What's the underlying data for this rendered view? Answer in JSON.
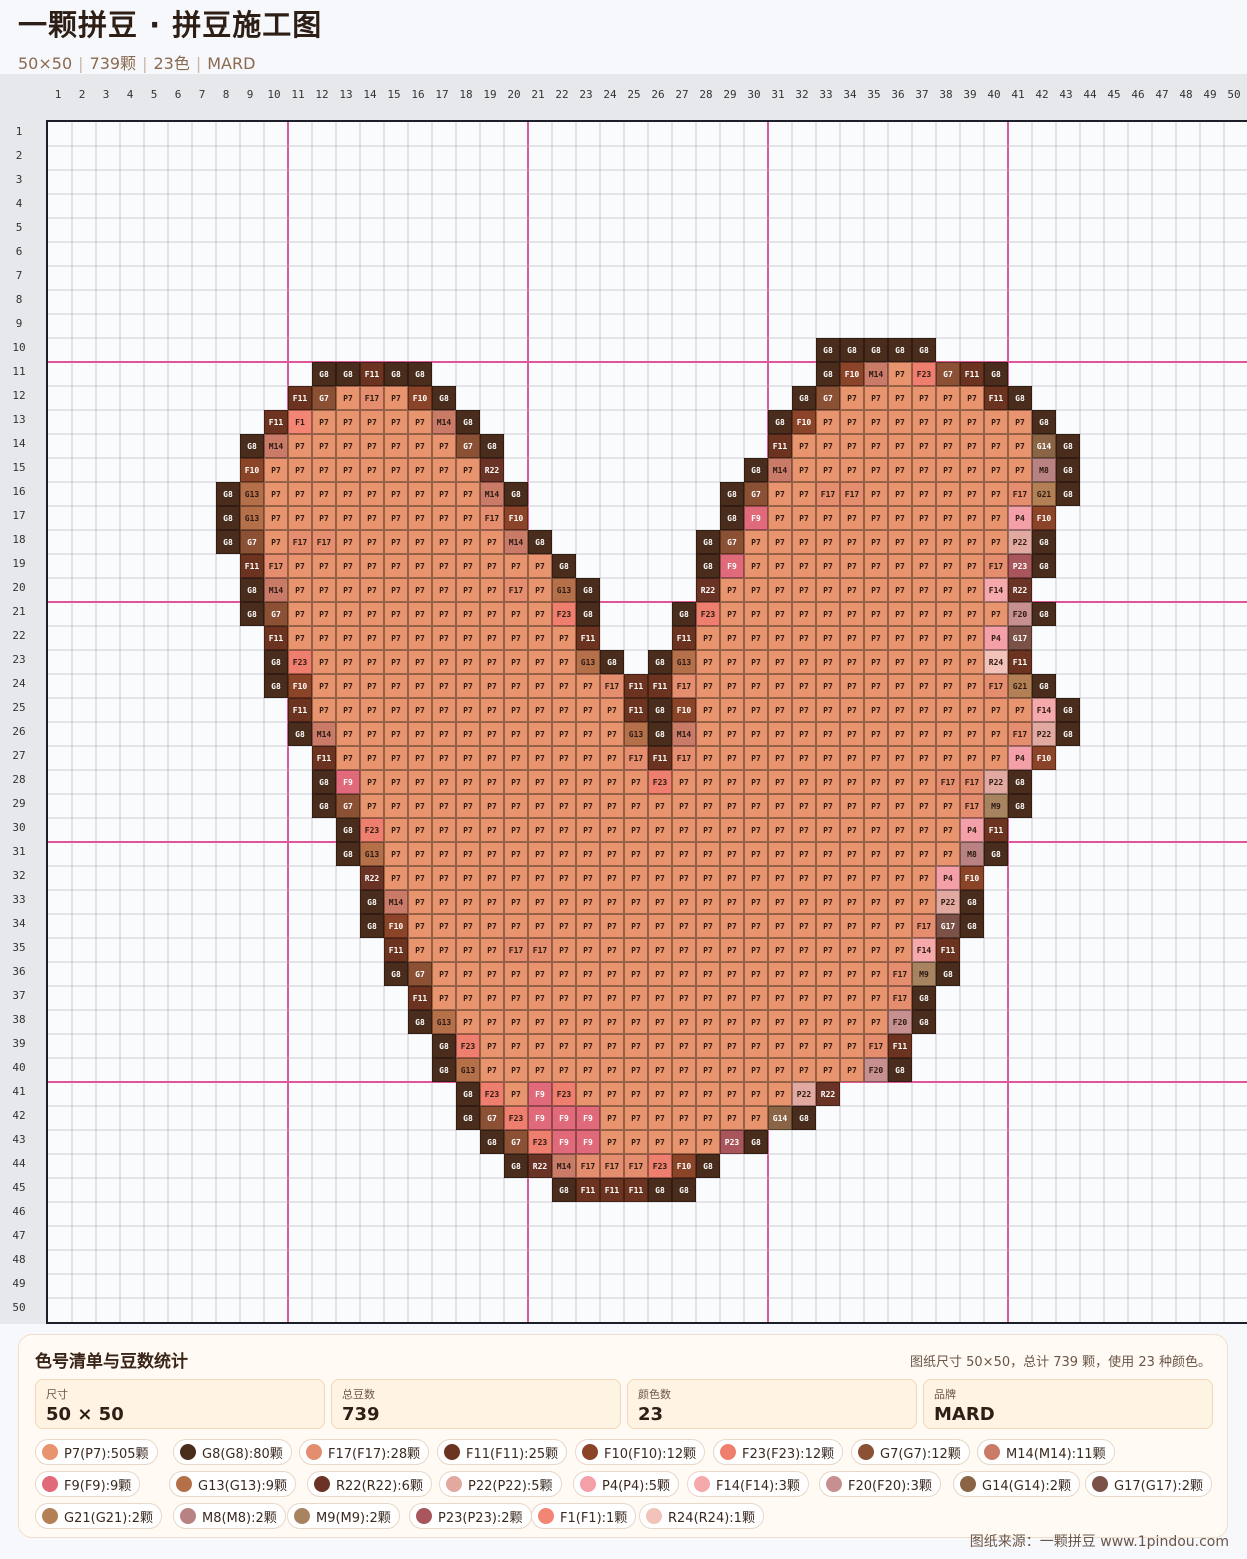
{
  "header": {
    "title": "一颗拼豆 · 拼豆施工图",
    "size": "50×50",
    "beads": "739颗",
    "colors": "23色",
    "brand": "MARD"
  },
  "grid": {
    "cols": 50,
    "rows": 50
  },
  "palette": {
    "P7": "#e8956f",
    "G8": "#4a2c1d",
    "F17": "#e58d6f",
    "F11": "#6b3320",
    "F10": "#8c4429",
    "F23": "#ee7f6e",
    "G7": "#8c5034",
    "M14": "#c97b67",
    "F9": "#e06a7a",
    "G13": "#b5704a",
    "R22": "#6a3326",
    "P22": "#e1a9a0",
    "P4": "#f4a0a8",
    "F14": "#f6a9aa",
    "F20": "#c79090",
    "G14": "#8a6445",
    "G17": "#7c5148",
    "G21": "#b38055",
    "M8": "#b88182",
    "M9": "#a88360",
    "P23": "#a8565c",
    "F1": "#f38574",
    "R24": "#f3c2b8"
  },
  "pattern_rows": {
    "10": "33:G8 G8 G8 G8 G8",
    "11": "12:G8 G8 F11 G8 G8|33:G8 F10 M14 P7 F23 G7 F11 G8",
    "12": "11:F11 G7 P7 F17 P7 F10 G8|32:G8 G7 P7 P7 P7 P7 P7 P7 F11 G8",
    "13": "10:F11 F1 P7 P7 P7 P7 P7 M14 G8|31:G8 F10 P7 P7 P7 P7 P7 P7 P7 P7 P7 G8",
    "14": "9:G8 M14 P7 P7 P7 P7 P7 P7 P7 G7 G8|31:F11 P7 P7 P7 P7 P7 P7 P7 P7 P7 P7 G14 G8",
    "15": "9:F10 P7 P7 P7 P7 P7 P7 P7 P7 P7 R22|30:G8 M14 P7 P7 P7 P7 P7 P7 P7 P7 P7 P7 M8 G8",
    "16": "8:G8 G13 P7 P7 P7 P7 P7 P7 P7 P7 P7 M14 G8|29:G8 G7 P7 P7 F17 F17 P7 P7 P7 P7 P7 P7 F17 G21 G8",
    "17": "8:G8 G13 P7 P7 P7 P7 P7 P7 P7 P7 P7 F17 F10|29:G8 F9 P7 P7 P7 P7 P7 P7 P7 P7 P7 P7 P4 F10",
    "18": "8:G8 G7 P7 F17 F17 P7 P7 P7 P7 P7 P7 P7 M14 G8|28:G8 G7 P7 P7 P7 P7 P7 P7 P7 P7 P7 P7 P7 P22 G8",
    "19": "9:F11 F17 P7 P7 P7 P7 P7 P7 P7 P7 P7 P7 P7 G8|28:G8 F9 P7 P7 P7 P7 P7 P7 P7 P7 P7 P7 F17 P23 G8",
    "20": "9:G8 M14 P7 P7 P7 P7 P7 P7 P7 P7 P7 F17 P7 G13 G8|28:R22 P7 P7 P7 P7 P7 P7 P7 P7 P7 P7 P7 F14 R22",
    "21": "9:G8 G7 P7 P7 P7 P7 P7 P7 P7 P7 P7 P7 P7 F23 G8|27:G8 F23 P7 P7 P7 P7 P7 P7 P7 P7 P7 P7 P7 P7 F20 G8",
    "22": "10:F11 P7 P7 P7 P7 P7 P7 P7 P7 P7 P7 P7 P7 F11|27:F11 P7 P7 P7 P7 P7 P7 P7 P7 P7 P7 P7 P7 P4 G17",
    "23": "10:G8 F23 P7 P7 P7 P7 P7 P7 P7 P7 P7 P7 P7 G13 G8|26:G8 G13 P7 P7 P7 P7 P7 P7 P7 P7 P7 P7 P7 P7 R24 F11",
    "24": "10:G8 F10 P7 P7 P7 P7 P7 P7 P7 P7 P7 P7 P7 P7 F17 F11|26:F11 F17 P7 P7 P7 P7 P7 P7 P7 P7 P7 P7 P7 P7 F17 G21 G8",
    "25": "11:F11 P7 P7 P7 P7 P7 P7 P7 P7 P7 P7 P7 P7 P7 F11 G8 F10 P7 P7 P7 P7 P7 P7 P7 P7 P7 P7 P7 P7 P7 P7 F14 G8",
    "26": "11:G8 M14 P7 P7 P7 P7 P7 P7 P7 P7 P7 P7 P7 P7 G13 G8 M14 P7 P7 P7 P7 P7 P7 P7 P7 P7 P7 P7 P7 P7 F17 P22 G8",
    "27": "12:F11 P7 P7 P7 P7 P7 P7 P7 P7 P7 P7 P7 P7 F17 F11 F17 P7 P7 P7 P7 P7 P7 P7 P7 P7 P7 P7 P7 P7 P4 F10",
    "28": "12:G8 F9 P7 P7 P7 P7 P7 P7 P7 P7 P7 P7 P7 P7 F23 P7 P7 P7 P7 P7 P7 P7 P7 P7 P7 P7 F17 F17 P22 G8",
    "29": "12:G8 G7 P7 P7 P7 P7 P7 P7 P7 P7 P7 P7 P7 P7 P7 P7 P7 P7 P7 P7 P7 P7 P7 P7 P7 P7 P7 F17 M9 G8",
    "30": "13:G8 F23 P7 P7 P7 P7 P7 P7 P7 P7 P7 P7 P7 P7 P7 P7 P7 P7 P7 P7 P7 P7 P7 P7 P7 P7 P4 F11",
    "31": "13:G8 G13 P7 P7 P7 P7 P7 P7 P7 P7 P7 P7 P7 P7 P7 P7 P7 P7 P7 P7 P7 P7 P7 P7 P7 P7 M8 G8",
    "32": "14:R22 P7 P7 P7 P7 P7 P7 P7 P7 P7 P7 P7 P7 P7 P7 P7 P7 P7 P7 P7 P7 P7 P7 P7 P4 F10",
    "33": "14:G8 M14 P7 P7 P7 P7 P7 P7 P7 P7 P7 P7 P7 P7 P7 P7 P7 P7 P7 P7 P7 P7 P7 P7 P22 G8",
    "34": "14:G8 F10 P7 P7 P7 P7 P7 P7 P7 P7 P7 P7 P7 P7 P7 P7 P7 P7 P7 P7 P7 P7 P7 F17 G17 G8",
    "35": "15:F11 P7 P7 P7 P7 F17 F17 P7 P7 P7 P7 P7 P7 P7 P7 P7 P7 P7 P7 P7 P7 P7 F14 F11",
    "36": "15:G8 G7 P7 P7 P7 P7 P7 P7 P7 P7 P7 P7 P7 P7 P7 P7 P7 P7 P7 P7 P7 F17 M9 G8",
    "37": "16:F11 P7 P7 P7 P7 P7 P7 P7 P7 P7 P7 P7 P7 P7 P7 P7 P7 P7 P7 P7 F17 G8",
    "38": "16:G8 G13 P7 P7 P7 P7 P7 P7 P7 P7 P7 P7 P7 P7 P7 P7 P7 P7 P7 P7 F20 G8",
    "39": "17:G8 F23 P7 P7 P7 P7 P7 P7 P7 P7 P7 P7 P7 P7 P7 P7 P7 P7 F17 F11",
    "40": "17:G8 G13 P7 P7 P7 P7 P7 P7 P7 P7 P7 P7 P7 P7 P7 P7 P7 P7 F20 G8",
    "41": "18:G8 F23 P7 F9 F23 P7 P7 P7 P7 P7 P7 P7 P7 P7 P22 R22",
    "42": "18:G8 G7 F23 F9 F9 F9 P7 P7 P7 P7 P7 P7 P7 G14 G8",
    "43": "19:G8 G7 F23 F9 F9 P7 P7 P7 P7 P7 P23 G8",
    "44": "20:G8 R22 M14 F17 F17 F17 F23 F10 G8",
    "45": "22:G8 F11 F11 F11 G8 G8"
  },
  "stats": {
    "title": "色号清单与豆数统计",
    "summary": "图纸尺寸 50×50，总计 739 颗，使用 23 种颜色。",
    "boxes": [
      {
        "label": "尺寸",
        "value": "50 × 50"
      },
      {
        "label": "总豆数",
        "value": "739"
      },
      {
        "label": "颜色数",
        "value": "23"
      },
      {
        "label": "品牌",
        "value": "MARD"
      }
    ]
  },
  "legend": [
    {
      "label": "P7(P7):505颗",
      "color": "#e8956f"
    },
    {
      "label": "G8(G8):80颗",
      "color": "#4a2c1d"
    },
    {
      "label": "F17(F17):28颗",
      "color": "#e58d6f"
    },
    {
      "label": "F11(F11):25颗",
      "color": "#6b3320"
    },
    {
      "label": "F10(F10):12颗",
      "color": "#8c4429"
    },
    {
      "label": "F23(F23):12颗",
      "color": "#ee7f6e"
    },
    {
      "label": "G7(G7):12颗",
      "color": "#8c5034"
    },
    {
      "label": "M14(M14):11颗",
      "color": "#c97b67"
    },
    {
      "label": "F9(F9):9颗",
      "color": "#e06a7a"
    },
    {
      "label": "G13(G13):9颗",
      "color": "#b5704a"
    },
    {
      "label": "R22(R22):6颗",
      "color": "#6a3326"
    },
    {
      "label": "P22(P22):5颗",
      "color": "#e1a9a0"
    },
    {
      "label": "P4(P4):5颗",
      "color": "#f4a0a8"
    },
    {
      "label": "F14(F14):3颗",
      "color": "#f6a9aa"
    },
    {
      "label": "F20(F20):3颗",
      "color": "#c79090"
    },
    {
      "label": "G14(G14):2颗",
      "color": "#8a6445"
    },
    {
      "label": "G17(G17):2颗",
      "color": "#7c5148"
    },
    {
      "label": "G21(G21):2颗",
      "color": "#b38055"
    },
    {
      "label": "M8(M8):2颗",
      "color": "#b88182"
    },
    {
      "label": "M9(M9):2颗",
      "color": "#a88360"
    },
    {
      "label": "P23(P23):2颗",
      "color": "#a8565c"
    },
    {
      "label": "F1(F1):1颗",
      "color": "#f38574"
    },
    {
      "label": "R24(R24):1颗",
      "color": "#f3c2b8"
    }
  ],
  "footer": "图纸来源：一颗拼豆 www.1pindou.com"
}
